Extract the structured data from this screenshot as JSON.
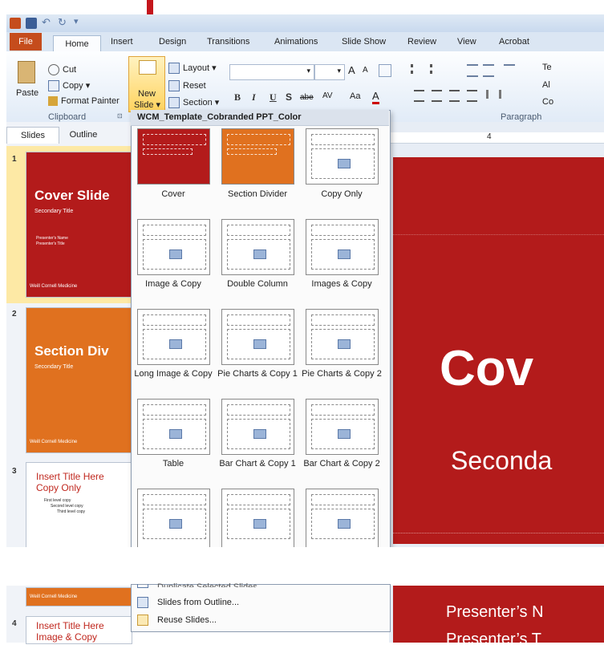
{
  "quick_access": {
    "app_icon": "powerpoint-app-icon",
    "save_icon": "save-icon",
    "undo_icon": "undo-icon",
    "redo_icon": "redo-icon",
    "customize_icon": "customize-icon"
  },
  "tabs": [
    "File",
    "Home",
    "Insert",
    "Design",
    "Transitions",
    "Animations",
    "Slide Show",
    "Review",
    "View",
    "Acrobat"
  ],
  "clipboard": {
    "paste": "Paste",
    "cut": "Cut",
    "copy": "Copy",
    "format_painter": "Format Painter",
    "group": "Clipboard"
  },
  "slides_group": {
    "new_slide_line1": "New",
    "new_slide_line2": "Slide",
    "layout": "Layout",
    "reset": "Reset",
    "section": "Section"
  },
  "paragraph_group": {
    "group": "Paragraph",
    "text_dir": "Te",
    "align_text": "Al",
    "convert": "Co"
  },
  "font_group": {
    "bold": "B",
    "italic": "I",
    "underline": "U",
    "shadow": "S",
    "strike": "abe",
    "spacing": "AV",
    "case": "Aa",
    "grow": "A",
    "shrink": "A"
  },
  "pane_tabs": {
    "slides": "Slides",
    "outline": "Outline"
  },
  "thumbnails": [
    {
      "num": "1",
      "title": "Cover Slide",
      "subtitle": "Secondary  Title",
      "presenter": "Presenter's Name",
      "presenter_title": "Presenter's Title",
      "footer": "Weill Cornell Medicine",
      "bg": "#b31b1b"
    },
    {
      "num": "2",
      "title": "Section Div",
      "subtitle": "Secondary  Title",
      "footer": "Weill Cornell Medicine",
      "bg": "#e0711f"
    },
    {
      "num": "3",
      "title_line1": "Insert Title Here",
      "title_line2": "Copy Only",
      "bullet1": "First level copy",
      "bullet2": "Second level copy",
      "bullet3": "Third level copy"
    },
    {
      "num": "4",
      "title_line1": "Insert Title Here",
      "title_line2": "Image & Copy"
    }
  ],
  "thumb2_footer": "Weill Cornell Medicine",
  "gallery": {
    "header": "WCM_Template_Cobranded PPT_Color",
    "layouts": [
      {
        "label": "Cover",
        "style": "red"
      },
      {
        "label": "Section Divider",
        "style": "orange"
      },
      {
        "label": "Copy Only",
        "style": "white"
      },
      {
        "label": "Image & Copy",
        "style": "white"
      },
      {
        "label": "Double Column",
        "style": "white"
      },
      {
        "label": "Images & Copy",
        "style": "white"
      },
      {
        "label": "Long Image & Copy",
        "style": "white"
      },
      {
        "label": "Pie Charts & Copy 1",
        "style": "white"
      },
      {
        "label": "Pie Charts & Copy 2",
        "style": "white"
      },
      {
        "label": "Table",
        "style": "white"
      },
      {
        "label": "Bar Chart & Copy 1",
        "style": "white"
      },
      {
        "label": "Bar Chart & Copy 2",
        "style": "white"
      },
      {
        "label": "",
        "style": "white"
      },
      {
        "label": "",
        "style": "white"
      },
      {
        "label": "",
        "style": "white"
      }
    ],
    "menu": {
      "duplicate": "Duplicate Selected Slides",
      "from_outline": "Slides from Outline...",
      "reuse": "Reuse Slides..."
    }
  },
  "slide": {
    "title": "Cov",
    "subtitle": "Seconda",
    "presenter": "Presenter’s N",
    "presenter2": "Presenter’s T"
  },
  "ruler_mark": "4",
  "colors": {
    "accent_red": "#b31b1b",
    "arrow": "#c4161c",
    "orange": "#e0711f"
  }
}
